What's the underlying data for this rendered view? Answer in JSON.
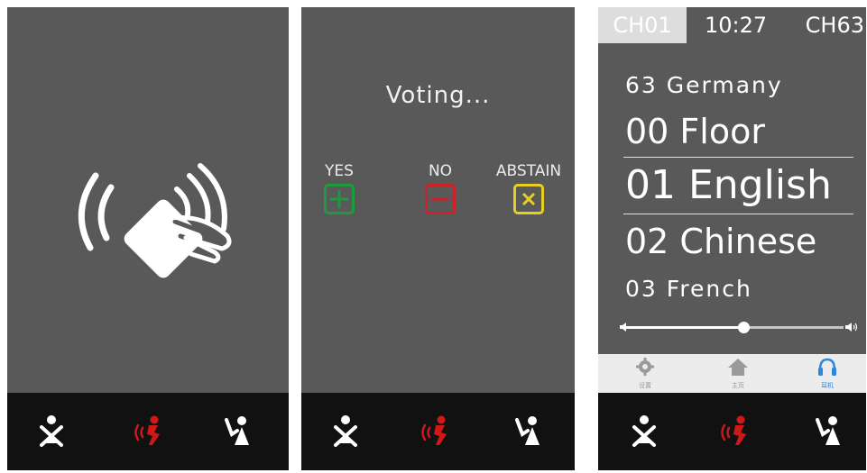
{
  "voting": {
    "title": "Voting...",
    "options": [
      {
        "label": "YES",
        "symbol": "+",
        "color": "#1f9b3f"
      },
      {
        "label": "NO",
        "symbol": "−",
        "color": "#d0202a"
      },
      {
        "label": "ABSTAIN",
        "symbol": "×",
        "color": "#e8d020"
      }
    ]
  },
  "channel": {
    "active_channel": "CH01",
    "time": "10:27",
    "current_channel": "CH63",
    "languages": [
      {
        "label": "63 Germany"
      },
      {
        "label": "00 Floor"
      },
      {
        "label": "01 English",
        "selected": true
      },
      {
        "label": "02 Chinese"
      },
      {
        "label": "03 French"
      }
    ],
    "volume_percent": 54,
    "tabs": [
      {
        "label": "设置",
        "icon": "gear-icon",
        "active": false
      },
      {
        "label": "主页",
        "icon": "home-icon",
        "active": false
      },
      {
        "label": "耳机",
        "icon": "headphones-icon",
        "active": true
      }
    ]
  },
  "bottom_bar_icons": [
    "disabled-person-icon",
    "speech-request-icon",
    "hand-raise-icon"
  ],
  "colors": {
    "panel_bg": "#5a5959",
    "bottom_bar_bg": "#111111",
    "speech_red": "#d01818",
    "tab_active_blue": "#2f86d8"
  }
}
